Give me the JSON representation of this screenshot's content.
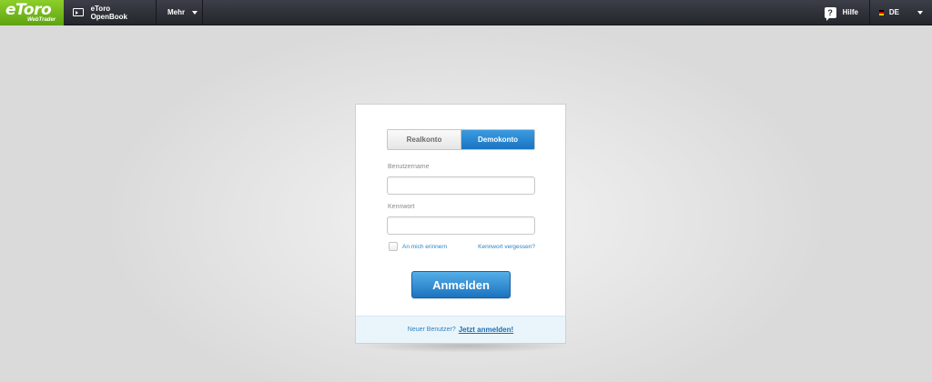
{
  "header": {
    "logo_text": "eToro",
    "logo_sub": "WebTrader",
    "openbook_label": "eToro OpenBook",
    "more_label": "Mehr",
    "help_label": "Hilfe",
    "help_icon": "?",
    "lang_label": "DE"
  },
  "login": {
    "tabs": [
      {
        "label": "Realkonto",
        "active": false
      },
      {
        "label": "Demokonto",
        "active": true
      }
    ],
    "username_label": "Benutzername",
    "username_value": "",
    "password_label": "Kennwort",
    "password_value": "",
    "remember_label": "An mich erinnern",
    "remember_checked": false,
    "forgot_label": "Kennwort vergessen?",
    "submit_label": "Anmelden",
    "footer_text": "Neuer Benutzer?",
    "footer_link": "Jetzt anmelden!"
  },
  "colors": {
    "brand_green": "#6fb81c",
    "primary_blue": "#1f78c5",
    "link_blue": "#2a84c6",
    "topbar": "#2d2f36"
  }
}
